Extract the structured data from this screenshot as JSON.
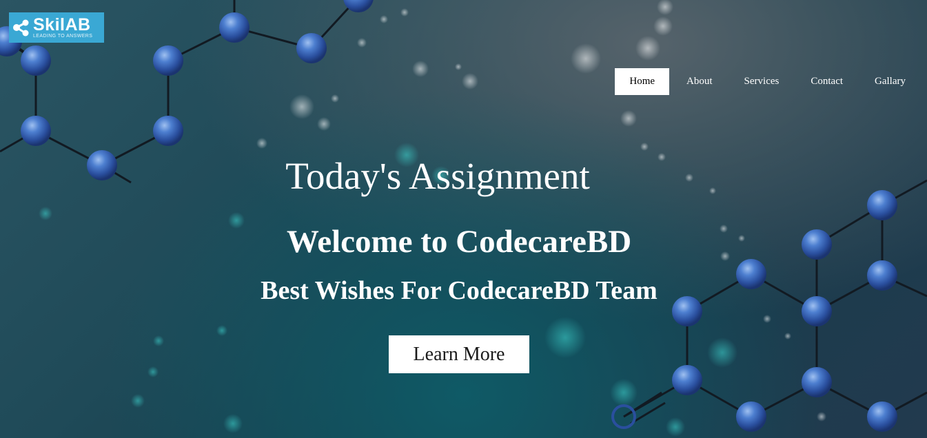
{
  "logo": {
    "name": "SkilAB",
    "tagline": "LEADING TO ANSWERS"
  },
  "nav": {
    "items": [
      {
        "label": "Home",
        "active": true
      },
      {
        "label": "About",
        "active": false
      },
      {
        "label": "Services",
        "active": false
      },
      {
        "label": "Contact",
        "active": false
      },
      {
        "label": "Gallary",
        "active": false
      }
    ]
  },
  "hero": {
    "title": "Today's Assignment",
    "heading": "Welcome to CodecareBD",
    "subheading": "Best Wishes For CodecareBD Team",
    "button_label": "Learn More"
  },
  "colors": {
    "logo_bg": "#3aa8d4",
    "molecule_atom": "#3f6fc4",
    "nav_active_bg": "#ffffff"
  },
  "icons": [
    "molecule-logo-icon"
  ]
}
